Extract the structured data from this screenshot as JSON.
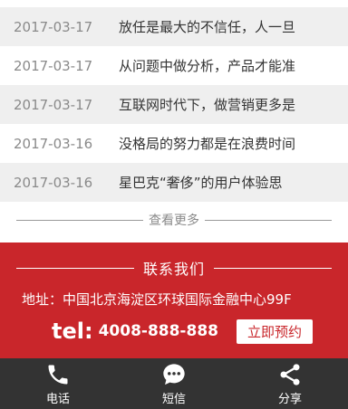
{
  "news": {
    "items": [
      {
        "date": "2017-03-17",
        "title": "放任是最大的不信任，人一旦"
      },
      {
        "date": "2017-03-17",
        "title": "从问题中做分析，产品才能准"
      },
      {
        "date": "2017-03-17",
        "title": "互联网时代下，做营销更多是"
      },
      {
        "date": "2017-03-16",
        "title": "没格局的努力都是在浪费时间"
      },
      {
        "date": "2017-03-16",
        "title": "星巴克“奢侈”的用户体验思"
      }
    ],
    "more_label": "查看更多"
  },
  "contact": {
    "heading": "联系我们",
    "address": "地址：中国北京海淀区环球国际金融中心99F",
    "tel_prefix": "tel:",
    "tel_number": "4008-888-888",
    "book_label": "立即预约",
    "background_color": "#c9262b"
  },
  "bottom_bar": {
    "items": [
      {
        "label": "电话",
        "icon": "phone-icon"
      },
      {
        "label": "短信",
        "icon": "message-icon"
      },
      {
        "label": "分享",
        "icon": "share-icon"
      }
    ],
    "background_color": "#333333"
  }
}
